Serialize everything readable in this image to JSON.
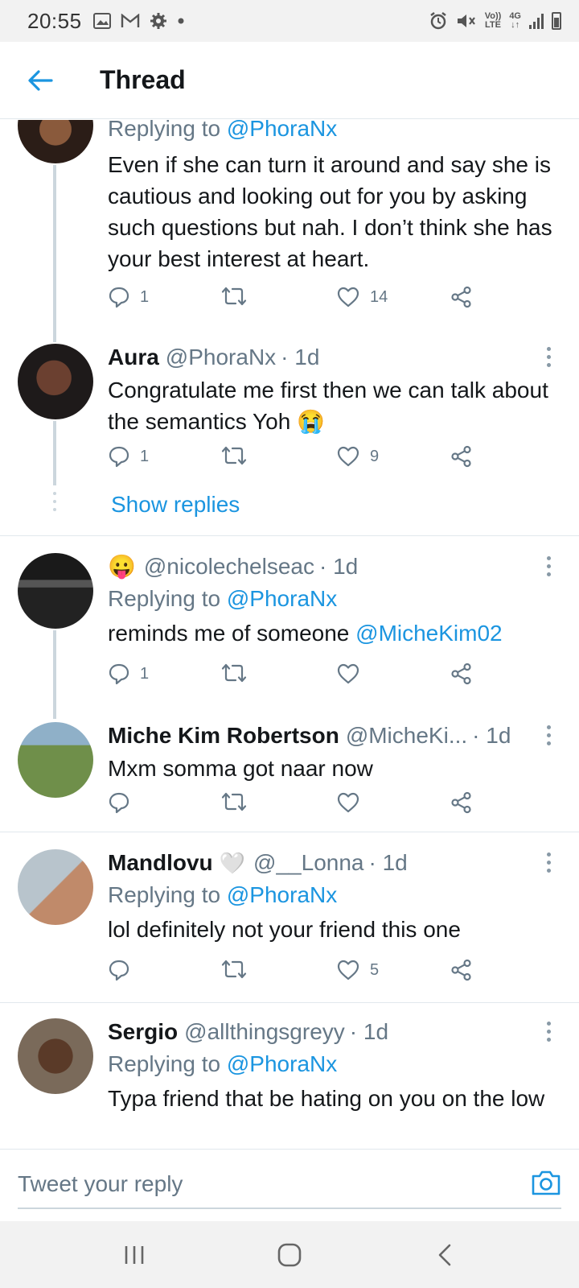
{
  "status_bar": {
    "time": "20:55",
    "left_icons": [
      "image-icon",
      "gmail-icon",
      "gear-icon",
      "dot-icon"
    ],
    "right_icons": [
      "alarm-icon",
      "mute-icon",
      "volte-icon",
      "4g-icon",
      "signal-icon",
      "battery-icon"
    ],
    "volte_line1": "Vo))",
    "volte_line2": "LTE",
    "net_line1": "4G",
    "net_line2": "↓↑"
  },
  "header": {
    "title": "Thread",
    "back_icon": "arrow-left-icon"
  },
  "tweets": [
    {
      "replying_prefix": "Replying to ",
      "replying_handle": "@PhoraNx",
      "text": "Even if she can turn it around and say she is cautious and looking out for you by asking such questions but nah. I don’t think she has your best interest at heart.",
      "replies": "1",
      "likes": "14"
    },
    {
      "name": "Aura",
      "handle": "@PhoraNx",
      "time": "· 1d",
      "text": "Congratulate me first then we can talk about the semantics Yoh 😭",
      "replies": "1",
      "likes": "9"
    },
    {
      "show_replies": "Show replies"
    },
    {
      "name_emoji": "😛",
      "handle": "@nicolechelseac",
      "time": "· 1d",
      "replying_prefix": "Replying to ",
      "replying_handle": "@PhoraNx",
      "text": "reminds me of someone ",
      "mention": "@MicheKim02",
      "replies": "1",
      "likes": ""
    },
    {
      "name": "Miche Kim Robertson",
      "handle": "@MicheKi...",
      "time": "· 1d",
      "text": "Mxm somma got naar now",
      "replies": "",
      "likes": ""
    },
    {
      "name": "Mandlovu",
      "name_emoji": "🤍",
      "handle": "@__Lonna",
      "time": "· 1d",
      "replying_prefix": "Replying to ",
      "replying_handle": "@PhoraNx",
      "text": "lol definitely not your friend this one",
      "replies": "",
      "likes": "5"
    },
    {
      "name": "Sergio",
      "handle": "@allthingsgreyy",
      "time": "· 1d",
      "replying_prefix": "Replying to ",
      "replying_handle": "@PhoraNx",
      "text": "Typa friend that be hating on you on the low"
    }
  ],
  "reply_bar": {
    "placeholder": "Tweet your reply",
    "camera_icon": "camera-icon"
  },
  "nav_bar": {
    "icons": [
      "recent-apps-icon",
      "home-icon",
      "back-icon"
    ]
  },
  "colors": {
    "accent": "#1b95e0",
    "secondary_text": "#657786",
    "divider": "#e1e8ed",
    "thread_line": "#ccd6dd"
  }
}
